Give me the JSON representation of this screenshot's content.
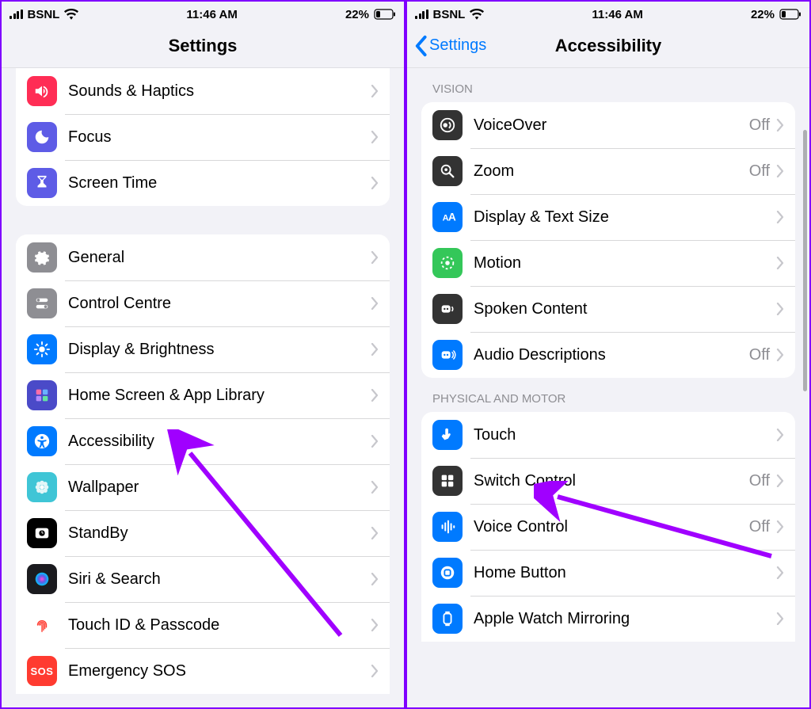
{
  "status": {
    "carrier": "BSNL",
    "time": "11:46 AM",
    "battery_pct": "22%"
  },
  "left": {
    "title": "Settings",
    "groupA": [
      {
        "label": "Sounds & Haptics",
        "icon": "speaker",
        "bg": "#ff2d55"
      },
      {
        "label": "Focus",
        "icon": "moon",
        "bg": "#5e5ce6"
      },
      {
        "label": "Screen Time",
        "icon": "hourglass",
        "bg": "#5e5ce6"
      }
    ],
    "groupB": [
      {
        "label": "General",
        "icon": "gear",
        "bg": "#8e8e93"
      },
      {
        "label": "Control Centre",
        "icon": "toggles",
        "bg": "#8e8e93"
      },
      {
        "label": "Display & Brightness",
        "icon": "sun",
        "bg": "#007aff"
      },
      {
        "label": "Home Screen & App Library",
        "icon": "grid",
        "bg": "#4a4ac8"
      },
      {
        "label": "Accessibility",
        "icon": "accessibility",
        "bg": "#007aff"
      },
      {
        "label": "Wallpaper",
        "icon": "flower",
        "bg": "#3fc5d6"
      },
      {
        "label": "StandBy",
        "icon": "clock",
        "bg": "#000000"
      },
      {
        "label": "Siri & Search",
        "icon": "siri",
        "bg": "#1b1b1f"
      },
      {
        "label": "Touch ID & Passcode",
        "icon": "fingerprint",
        "bg": "#ffffff",
        "fg": "#ff3b30"
      },
      {
        "label": "Emergency SOS",
        "icon": "sos",
        "bg": "#ff3b30",
        "text": "SOS"
      }
    ]
  },
  "right": {
    "back": "Settings",
    "title": "Accessibility",
    "vision_header": "VISION",
    "vision": [
      {
        "label": "VoiceOver",
        "value": "Off",
        "icon": "voiceover",
        "bg": "#333333"
      },
      {
        "label": "Zoom",
        "value": "Off",
        "icon": "zoom",
        "bg": "#333333"
      },
      {
        "label": "Display & Text Size",
        "icon": "textsize",
        "bg": "#007aff"
      },
      {
        "label": "Motion",
        "icon": "motion",
        "bg": "#34c759"
      },
      {
        "label": "Spoken Content",
        "icon": "spoken",
        "bg": "#333333"
      },
      {
        "label": "Audio Descriptions",
        "value": "Off",
        "icon": "audiodesc",
        "bg": "#007aff"
      }
    ],
    "motor_header": "PHYSICAL AND MOTOR",
    "motor": [
      {
        "label": "Touch",
        "icon": "touch",
        "bg": "#007aff"
      },
      {
        "label": "Switch Control",
        "value": "Off",
        "icon": "switch",
        "bg": "#333333"
      },
      {
        "label": "Voice Control",
        "value": "Off",
        "icon": "voicecontrol",
        "bg": "#007aff"
      },
      {
        "label": "Home Button",
        "icon": "homebutton",
        "bg": "#007aff"
      },
      {
        "label": "Apple Watch Mirroring",
        "icon": "watch",
        "bg": "#007aff"
      }
    ]
  },
  "icons": {
    "speaker": "<path fill='#fff' d='M3 9v6h4l5 4V5L7 9H3zm13 3a4 4 0 0 0-2-3.4v6.8A4 4 0 0 0 16 12zm-2-7v2.1c2.3.8 4 3 4 5.9s-1.7 5.1-4 5.9V21c3.4-.9 6-4 6-8s-2.6-7.1-6-8z'/>",
    "moon": "<path fill='#fff' d='M12 3a9 9 0 1 0 9 9 7 7 0 0 1-9-9z'/>",
    "hourglass": "<path fill='#fff' d='M6 2h12v2l-4 4v4l4 4v2H6v-2l4-4V8L6 4V2zm2 2l4 4 4-4H8z'/>",
    "gear": "<path fill='#fff' d='M12 8a4 4 0 1 0 0 8 4 4 0 0 0 0-8zm8 4l2-1-1-3-2 .5-2-2 .5-2-3-1-1 2h-3l-1-2-3 1 .5 2-2 2-2-.5-1 3 2 1v2l-2 1 1 3 2-.5 2 2-.5 2 3 1 1-2h3l1 2 3-1-.5-2 2-2 2 .5 1-3-2-1v-2z'/>",
    "toggles": "<rect x='4' y='5' width='16' height='5' rx='2.5' fill='#fff'/><circle cx='7' cy='7.5' r='2' fill='#8e8e93'/><rect x='4' y='14' width='16' height='5' rx='2.5' fill='#fff'/><circle cx='17' cy='16.5' r='2' fill='#8e8e93'/>",
    "sun": "<circle cx='12' cy='12' r='4' fill='#fff'/><g stroke='#fff' stroke-width='2' stroke-linecap='round'><line x1='12' y1='2' x2='12' y2='5'/><line x1='12' y1='19' x2='12' y2='22'/><line x1='2' y1='12' x2='5' y2='12'/><line x1='19' y1='12' x2='22' y2='12'/><line x1='5' y1='5' x2='7' y2='7'/><line x1='17' y1='17' x2='19' y2='19'/><line x1='17' y1='7' x2='19' y2='5'/><line x1='5' y1='19' x2='7' y2='17'/></g>",
    "grid": "<rect x='4' y='4' width='7' height='7' rx='1.5' fill='#ff6ea8'/><rect x='13' y='4' width='7' height='7' rx='1.5' fill='#6ab0ff'/><rect x='4' y='13' width='7' height='7' rx='1.5' fill='#b38bff'/><rect x='13' y='13' width='7' height='7' rx='1.5' fill='#64e3a1'/>",
    "accessibility": "<circle cx='12' cy='12' r='10' fill='#fff'/><circle cx='12' cy='7' r='2' fill='#007aff'/><path fill='#007aff' d='M6 10l6 1 6-1v2l-4 1v3l2 5h-2l-2-4-2 4H8l2-5v-3l-4-1z'/>",
    "flower": "<circle cx='12' cy='12' r='3' fill='#fff'/><g fill='#fff' opacity='.85'><circle cx='12' cy='6' r='3'/><circle cx='12' cy='18' r='3'/><circle cx='6' cy='12' r='3'/><circle cx='18' cy='12' r='3'/><circle cx='7.5' cy='7.5' r='3'/><circle cx='16.5' cy='16.5' r='3'/><circle cx='16.5' cy='7.5' r='3'/><circle cx='7.5' cy='16.5' r='3'/></g>",
    "clock": "<rect x='3' y='5' width='18' height='14' rx='3' fill='#fff'/><circle cx='12' cy='12' r='4' fill='#000'/><line x1='12' y1='12' x2='12' y2='9' stroke='#fff'/><line x1='12' y1='12' x2='14' y2='12' stroke='#fff'/>",
    "siri": "<defs><radialGradient id='sg'><stop offset='0' stop-color='#ff4cd8'/><stop offset='.5' stop-color='#5e5ce6'/><stop offset='1' stop-color='#00c7ff'/></radialGradient></defs><circle cx='12' cy='12' r='9' fill='url(#sg)'/>",
    "fingerprint": "<g fill='none' stroke='currentColor' stroke-width='1.5' stroke-linecap='round'><path d='M6 12a6 6 0 0 1 12 0v3'/><path d='M8 12a4 4 0 0 1 8 0v5'/><path d='M10 12a2 2 0 0 1 4 0v7'/><path d='M12 12v9'/></g>",
    "sos": "",
    "voiceover": "<circle cx='12' cy='12' r='9' fill='none' stroke='#fff' stroke-width='2'/><circle cx='9' cy='12' r='3' fill='#fff'/><path d='M14 8a5 5 0 0 1 0 8' fill='none' stroke='#fff' stroke-width='2'/>",
    "zoom": "<circle cx='10' cy='10' r='6' fill='none' stroke='#fff' stroke-width='2'/><line x1='14.5' y1='14.5' x2='20' y2='20' stroke='#fff' stroke-width='2.5' stroke-linecap='round'/><circle cx='10' cy='10' r='2' fill='#fff'/>",
    "textsize": "<text x='5' y='17' font-size='12' font-weight='700' fill='#fff'>A</text><text x='13' y='17' font-size='15' font-weight='700' fill='#fff'>A</text>",
    "motion": "<circle cx='12' cy='12' r='8' fill='none' stroke='#fff' stroke-width='2' stroke-dasharray='3 3'/><circle cx='12' cy='12' r='3' fill='#fff'/>",
    "spoken": "<rect x='4' y='7' width='12' height='10' rx='3' fill='#fff'/><circle cx='8' cy='12' r='1.3' fill='#333'/><circle cx='12' cy='12' r='1.3' fill='#333'/><path d='M18 9a4 4 0 0 1 0 6' stroke='#fff' stroke-width='1.8' fill='none'/>",
    "audiodesc": "<rect x='4' y='7' width='12' height='10' rx='3' fill='#fff'/><circle cx='8' cy='12' r='1.3' fill='#007aff'/><circle cx='12' cy='12' r='1.3' fill='#007aff'/><path d='M18 8a5 5 0 0 1 0 8M20 6a8 8 0 0 1 0 12' stroke='#fff' stroke-width='1.6' fill='none'/>",
    "touch": "<path fill='#fff' d='M11 3a2 2 0 0 1 2 2v6l1-1a1.5 1.5 0 0 1 2 2l-3 5-5 2-4-5 2-3 3 1V5a2 2 0 0 1 2-2z'/>",
    "switch": "<rect x='4' y='4' width='7' height='7' rx='1.5' fill='#fff'/><rect x='13' y='4' width='7' height='7' rx='1.5' fill='#fff'/><rect x='4' y='13' width='7' height='7' rx='1.5' fill='#fff'/><rect x='13' y='13' width='7' height='7' rx='1.5' fill='#fff'/>",
    "voicecontrol": "<g stroke='#fff' stroke-width='2.2' stroke-linecap='round'><line x1='5' y1='10' x2='5' y2='14'/><line x1='9' y1='7' x2='9' y2='17'/><line x1='13' y1='4' x2='13' y2='20'/><line x1='17' y1='8' x2='17' y2='16'/><line x1='21' y1='11' x2='21' y2='13'/></g>",
    "homebutton": "<circle cx='12' cy='12' r='9' fill='#fff'/><rect x='8' y='8' width='8' height='8' rx='2' fill='none' stroke='#007aff' stroke-width='2'/>",
    "watch": "<rect x='7' y='5' width='10' height='14' rx='3' fill='none' stroke='#fff' stroke-width='2'/><rect x='9' y='2' width='6' height='3' fill='#fff'/><rect x='9' y='19' width='6' height='3' fill='#fff'/>"
  }
}
